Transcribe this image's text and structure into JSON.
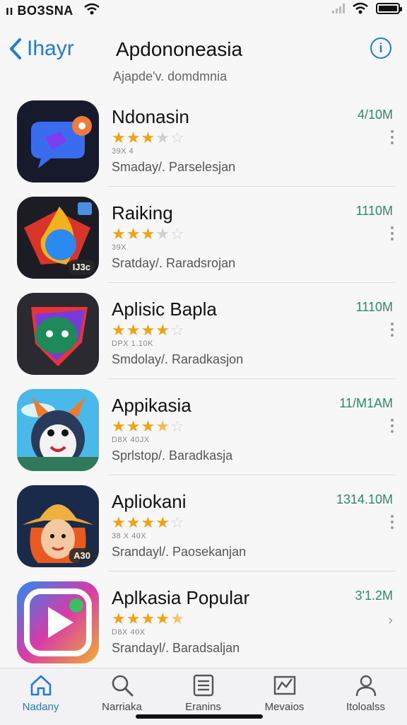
{
  "status": {
    "carrier": "ıı BOЗSNA"
  },
  "nav": {
    "back_label": "Ihayr",
    "title": "Apdononeasia",
    "info_label": "i"
  },
  "subtitle": "Ajapde'v. domdmnia",
  "apps": [
    {
      "name": "Ndonasin",
      "rating": 3,
      "meta": "39X 4",
      "category": "Smaday/. Parselesjan",
      "size": "4/10M",
      "action": "more"
    },
    {
      "name": "Raiking",
      "rating": 3,
      "meta": "39X",
      "category": "Sratday/. Raradsrojan",
      "size": "1110M",
      "action": "more",
      "badge": "IJ3c"
    },
    {
      "name": "Aplisic Bapla",
      "rating": 4,
      "meta": "DPX 1.10K",
      "category": "Smdolay/. Raradkasjon",
      "size": "1110M",
      "action": "more"
    },
    {
      "name": "Appikasia",
      "rating": 3.5,
      "meta": "D8X 40JX",
      "category": "Sprlstop/. Baradkasja",
      "size": "11/M1AM",
      "action": "more"
    },
    {
      "name": "Apliokani",
      "rating": 4,
      "meta": "38 X 40X",
      "category": "Srandayl/. Paosekanjan",
      "size": "1314.10M",
      "action": "more",
      "badge": "A30"
    },
    {
      "name": "Aplkasia Popular",
      "rating": 4.5,
      "meta": "D8X 40X",
      "category": "Srandayl/. Baradsaljan",
      "size": "3'1.2M",
      "action": "chevron"
    }
  ],
  "tabs": [
    {
      "label": "Nadany",
      "icon": "home-icon",
      "active": true
    },
    {
      "label": "Narriaka",
      "icon": "search-icon",
      "active": false
    },
    {
      "label": "Eranins",
      "icon": "list-icon",
      "active": false
    },
    {
      "label": "Mevaios",
      "icon": "chart-icon",
      "active": false
    },
    {
      "label": "Itoloalss",
      "icon": "person-icon",
      "active": false
    }
  ],
  "colors": {
    "accent": "#1e7be0",
    "star": "#f2a20c",
    "size_text": "#2a8a6a"
  }
}
